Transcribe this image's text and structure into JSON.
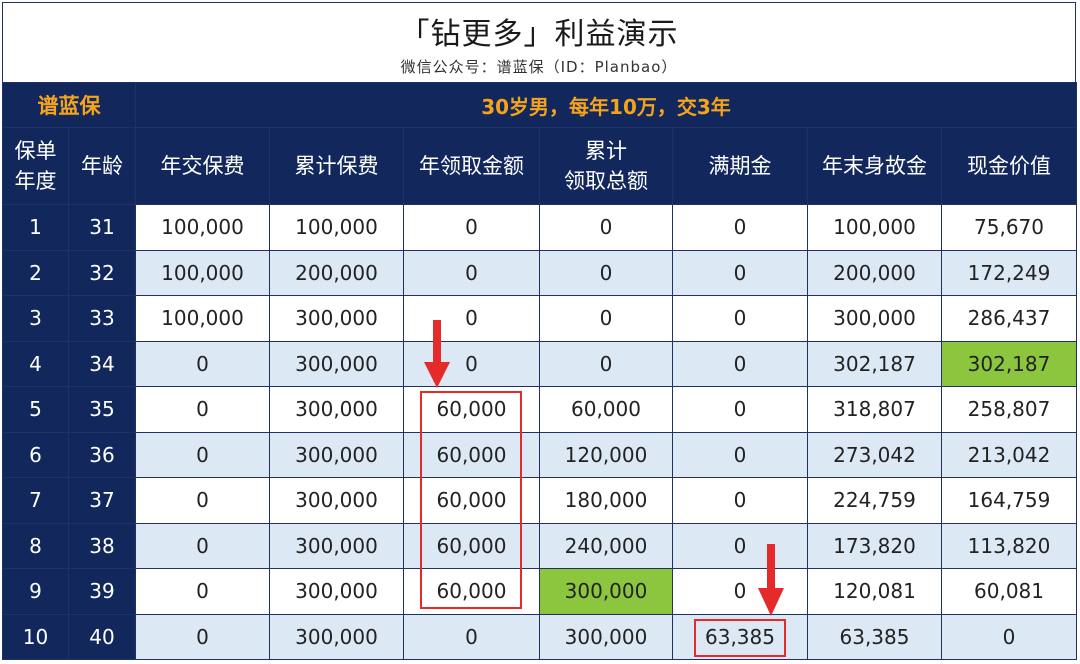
{
  "header": {
    "title": "「钻更多」利益演示",
    "subtitle": "微信公众号：谱蓝保（ID：Planbao）"
  },
  "banner": {
    "brand": "谱蓝保",
    "scenario": "30岁男，每年10万，交3年"
  },
  "columns": {
    "policy_year": "保单年度",
    "policy_year_l1": "保单",
    "policy_year_l2": "年度",
    "age": "年龄",
    "annual_premium": "年交保费",
    "cumulative_premium": "累计保费",
    "annual_payout": "年领取金额",
    "cumulative_payout_l1": "累计",
    "cumulative_payout_l2": "领取总额",
    "maturity": "满期金",
    "death_benefit": "年末身故金",
    "cash_value": "现金价值"
  },
  "rows": [
    [
      "1",
      "31",
      "100,000",
      "100,000",
      "0",
      "0",
      "0",
      "100,000",
      "75,670"
    ],
    [
      "2",
      "32",
      "100,000",
      "200,000",
      "0",
      "0",
      "0",
      "200,000",
      "172,249"
    ],
    [
      "3",
      "33",
      "100,000",
      "300,000",
      "0",
      "0",
      "0",
      "300,000",
      "286,437"
    ],
    [
      "4",
      "34",
      "0",
      "300,000",
      "0",
      "0",
      "0",
      "302,187",
      "302,187"
    ],
    [
      "5",
      "35",
      "0",
      "300,000",
      "60,000",
      "60,000",
      "0",
      "318,807",
      "258,807"
    ],
    [
      "6",
      "36",
      "0",
      "300,000",
      "60,000",
      "120,000",
      "0",
      "273,042",
      "213,042"
    ],
    [
      "7",
      "37",
      "0",
      "300,000",
      "60,000",
      "180,000",
      "0",
      "224,759",
      "164,759"
    ],
    [
      "8",
      "38",
      "0",
      "300,000",
      "60,000",
      "240,000",
      "0",
      "173,820",
      "113,820"
    ],
    [
      "9",
      "39",
      "0",
      "300,000",
      "60,000",
      "300,000",
      "0",
      "120,081",
      "60,081"
    ],
    [
      "10",
      "40",
      "0",
      "300,000",
      "0",
      "300,000",
      "63,385",
      "63,385",
      "0"
    ]
  ],
  "highlights": {
    "green_cells": [
      "row4-cash_value",
      "row9-cumulative_payout"
    ],
    "red_boxes": [
      "annual_payout rows 5-9",
      "maturity row 10"
    ],
    "red_arrows": [
      "annual_payout above row 4",
      "maturity above row 9"
    ]
  },
  "colors": {
    "navy": "#12285c",
    "orange": "#f5a31a",
    "light_blue_row": "#dde8f5",
    "green": "#8cc63f",
    "red": "#e52a2a"
  }
}
